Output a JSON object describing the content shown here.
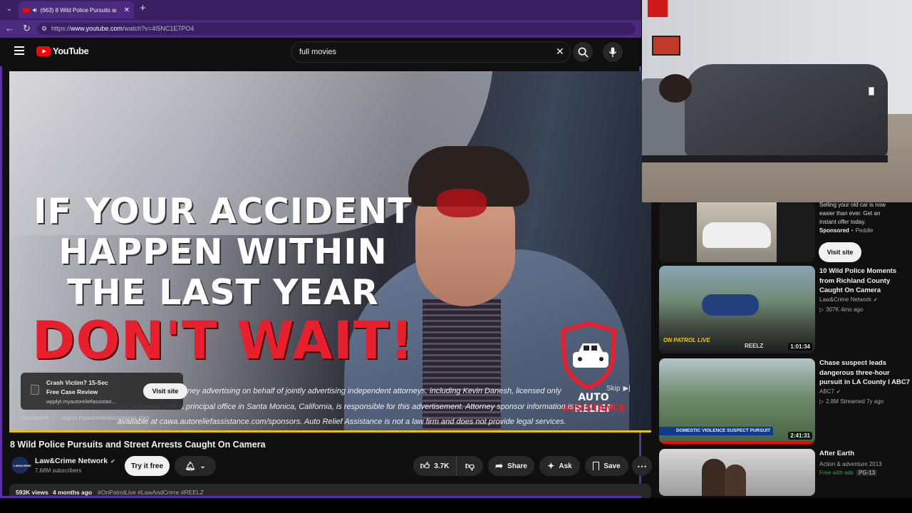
{
  "browser": {
    "tab_title": "(663) 8 Wild Police Pursuits an",
    "url_prefix": "https://",
    "url_host": "www.youtube.com",
    "url_path": "/watch?v=4I5NC1E7PO4",
    "new_tab_symbol": "+"
  },
  "youtube": {
    "logo_text": "YouTube",
    "search_value": "full movies"
  },
  "video": {
    "headline_lines": [
      "IF YOUR ACCIDENT",
      "HAPPEN WITHIN",
      "THE LAST YEAR"
    ],
    "headline_red": "DON'T WAIT!",
    "brand_line1": "AUTO RELIEF",
    "brand_line2": "ASSISTANCE",
    "disclaimer_lines": [
      "attorney advertising on behalf of jointly advertising independent attorneys, including Kevin Danesh, licensed only",
      "in California, with a principal office in Santa Monica, California, is responsible for this advertisement. Attorney sponsor information is",
      "available at cawa.autoreliefassistance.com/sponsors. Auto Relief Assistance is not a law firm and does not provide legal services."
    ],
    "skip_label": "Skip",
    "ad_card": {
      "title": "Crash Victim? 15-Sec Free Case Review",
      "domain": "wpplyt.myautoreliefassistan...",
      "button": "Visit site"
    },
    "sponsored_label": "Sponsored",
    "sponsored_domain": "wpplyt.myautoreliefassistance.com"
  },
  "watch": {
    "title": "8 Wild Police Pursuits and Street Arrests Caught On Camera",
    "channel_name": "Law&Crime Network",
    "channel_avatar_text": "LAW&CRIME",
    "subscribers": "7.68M subscribers",
    "try_button": "Try it free",
    "likes": "3.7K",
    "share": "Share",
    "ask": "Ask",
    "save": "Save",
    "views": "593K views",
    "age": "4 months ago",
    "hashtags": "#OnPatrolLive #LawAndCrime #REELZ"
  },
  "sidebar": {
    "ad": {
      "desc": "Selling your old car is now easier than ever. Get an instant offer today.",
      "sponsored": "Sponsored",
      "advertiser": "Peddle",
      "button": "Visit site"
    },
    "items": [
      {
        "title": "10 Wild Police Moments from Richland County Caught On Camera",
        "channel": "Law&Crime Network",
        "meta": "307K  4mo ago",
        "duration": "1:01:34",
        "badge": "ON PATROL LIVE",
        "net": "REELZ"
      },
      {
        "title": "Chase suspect leads dangerous three-hour pursuit in LA County I ABC7",
        "channel": "ABC7",
        "meta": "2.8M  Streamed 7y ago",
        "duration": "2:41:31",
        "banner": "DOMESTIC VIOLENCE SUSPECT PURSUIT"
      },
      {
        "title": "After Earth",
        "genre": "Action & adventure 2013",
        "free": "Free with ads",
        "rating": "PG-13"
      }
    ]
  },
  "colors": {
    "accent_purple": "#4b2a80",
    "yt_red": "#ff0000",
    "ad_red": "#e8202e",
    "progress_yellow": "#e7c400"
  }
}
